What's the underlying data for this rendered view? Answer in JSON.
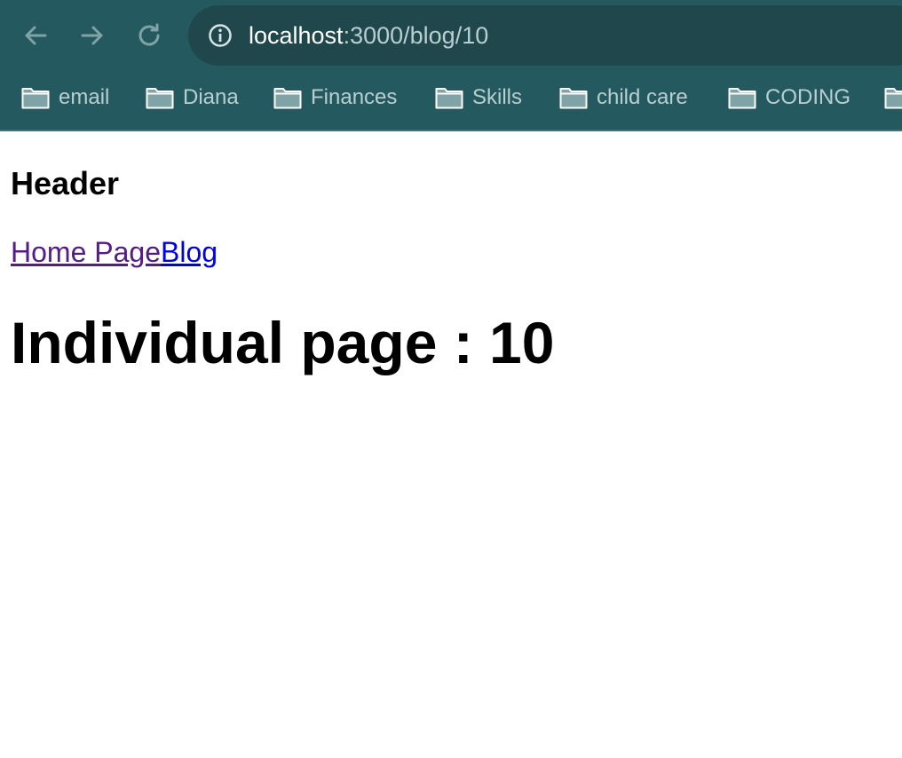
{
  "browser": {
    "url_host": "localhost",
    "url_rest": ":3000/blog/10",
    "icons": {
      "back": "arrow-left-icon",
      "forward": "arrow-right-icon",
      "reload": "reload-icon",
      "site_info": "info-icon",
      "folder": "folder-icon"
    },
    "bookmarks": [
      {
        "label": "email"
      },
      {
        "label": "Diana"
      },
      {
        "label": "Finances"
      },
      {
        "label": "Skills"
      },
      {
        "label": "child care"
      },
      {
        "label": "CODING"
      }
    ],
    "colors": {
      "toolbar": "#245a5f",
      "omnibox": "#1f474c",
      "muted_text": "#b8cfd1"
    }
  },
  "page": {
    "header": "Header",
    "nav": {
      "home_label": "Home Page",
      "blog_label": "Blog"
    },
    "title": "Individual page : 10",
    "colors": {
      "visited_link": "#551a8b",
      "link": "#0000ee"
    }
  }
}
